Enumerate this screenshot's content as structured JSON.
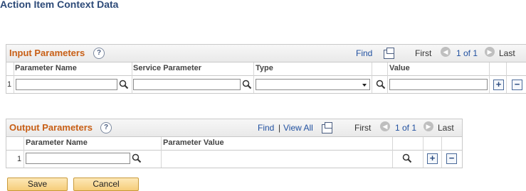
{
  "page": {
    "title": "Action Item Context Data"
  },
  "input_grid": {
    "title": "Input Parameters",
    "find": "Find",
    "first": "First",
    "pager": "1 of 1",
    "last": "Last",
    "columns": [
      "Parameter Name",
      "Service Parameter",
      "Type",
      "Value"
    ],
    "row_number": "1"
  },
  "output_grid": {
    "title": "Output Parameters",
    "find": "Find",
    "sep": "|",
    "view_all": "View All",
    "first": "First",
    "pager": "1 of 1",
    "last": "Last",
    "columns": [
      "Parameter Name",
      "Parameter Value"
    ],
    "row_number": "1"
  },
  "buttons": {
    "save": "Save",
    "cancel": "Cancel"
  },
  "icons": {
    "help": "help-icon",
    "popout": "popout-icon",
    "lookup": "magnifier-icon",
    "add": "plus-icon",
    "delete": "minus-icon",
    "prev": "chevron-left-icon",
    "next": "chevron-right-icon"
  },
  "colors": {
    "grid_title": "#c85f16",
    "page_title": "#2d4a78",
    "link": "#2050a0",
    "button": "#f6cd7a"
  }
}
